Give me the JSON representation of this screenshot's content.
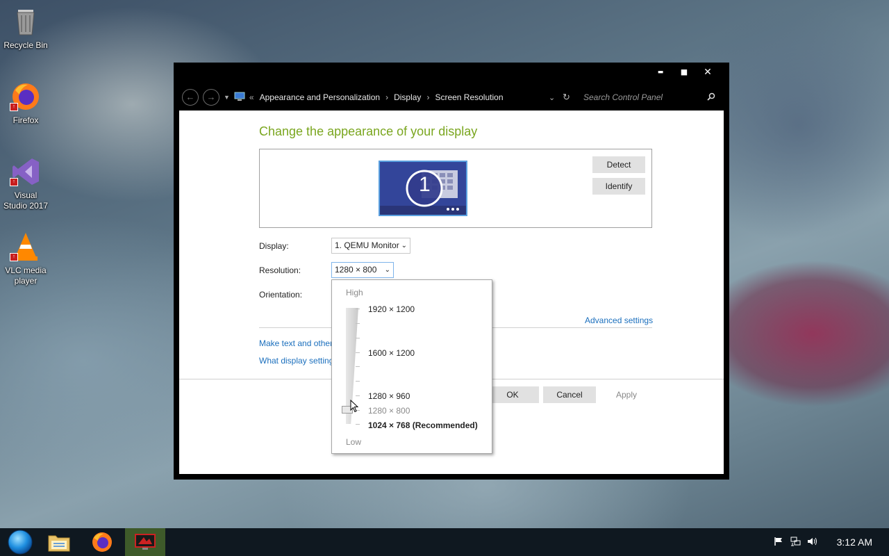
{
  "desktop": {
    "icons": [
      {
        "label": "Recycle Bin"
      },
      {
        "label": "Firefox"
      },
      {
        "label": "Visual Studio 2017"
      },
      {
        "label": "VLC media player"
      }
    ]
  },
  "window": {
    "controls": {
      "minimize": "▬",
      "maximize": "■",
      "close": "✕"
    },
    "breadcrumbs": [
      "Appearance and Personalization",
      "Display",
      "Screen Resolution"
    ],
    "breadcrumb_lead": "«",
    "search_placeholder": "Search Control Panel",
    "heading": "Change the appearance of your display",
    "monitor_number": "1",
    "detect_label": "Detect",
    "identify_label": "Identify",
    "display_label": "Display:",
    "display_value": "1. QEMU Monitor",
    "resolution_label": "Resolution:",
    "resolution_value": "1280 × 800",
    "orientation_label": "Orientation:",
    "advanced_link": "Advanced settings",
    "link1": "Make text and other",
    "link2": "What display setting",
    "ok_label": "OK",
    "cancel_label": "Cancel",
    "apply_label": "Apply"
  },
  "dropdown": {
    "high_label": "High",
    "low_label": "Low",
    "options": [
      "1920 × 1200",
      "1600 × 1200",
      "1280 × 960",
      "1280 × 800",
      "1024 × 768 (Recommended)"
    ]
  },
  "taskbar": {
    "clock": "3:12 AM"
  }
}
